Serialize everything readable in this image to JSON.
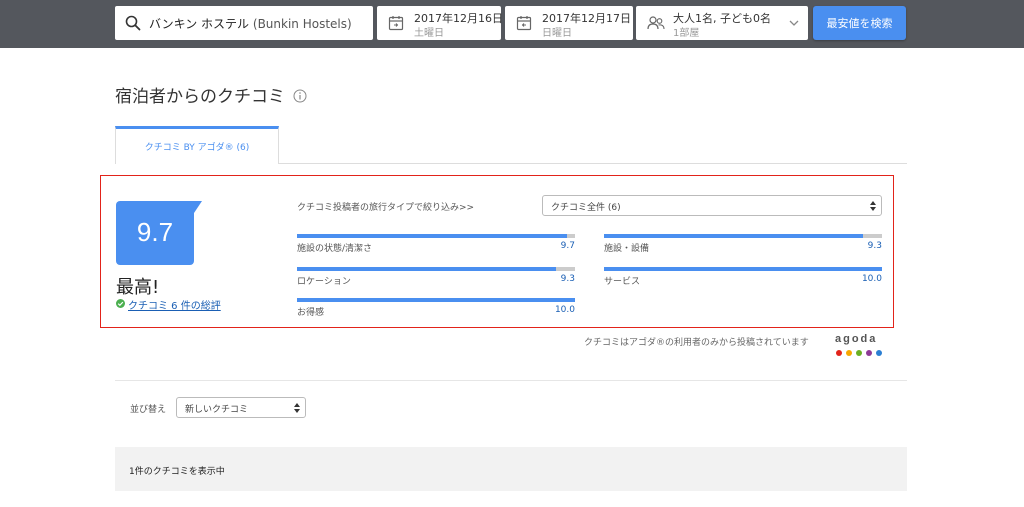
{
  "search": {
    "hotel_name": "バンキン ホステル",
    "hotel_en": "(Bunkin Hostels)",
    "checkin_date": "2017年12月16日",
    "checkin_day": "土曜日",
    "checkout_date": "2017年12月17日",
    "checkout_day": "日曜日",
    "guests": "大人1名, 子ども0名",
    "rooms": "1部屋",
    "button_label": "最安値を検索"
  },
  "page": {
    "title": "宿泊者からのクチコミ"
  },
  "tabs": [
    {
      "label": "クチコミ BY アゴダ® (6)"
    }
  ],
  "summary": {
    "score": "9.7",
    "score_word": "最高!",
    "total_link": "クチコミ 6 件の総評",
    "filter_label": "クチコミ投稿者の旅行タイプで絞り込み>>",
    "filter_value": "クチコミ全件 (6)",
    "categories": [
      {
        "label": "施設の状態/清潔さ",
        "value": "9.7",
        "fraction": 0.97
      },
      {
        "label": "施設・設備",
        "value": "9.3",
        "fraction": 0.93
      },
      {
        "label": "ロケーション",
        "value": "9.3",
        "fraction": 0.93
      },
      {
        "label": "サービス",
        "value": "10.0",
        "fraction": 1.0
      },
      {
        "label": "お得感",
        "value": "10.0",
        "fraction": 1.0
      }
    ]
  },
  "notice": {
    "text": "クチコミはアゴダ®の利用者のみから投稿されています",
    "logo_text": "agoda",
    "logo_colors": [
      "#e2231a",
      "#f7a800",
      "#6ab023",
      "#8e3a96",
      "#2b7fd3"
    ]
  },
  "sort": {
    "label": "並び替え",
    "value": "新しいクチコミ"
  },
  "results": {
    "count_text": "1件のクチコミを表示中"
  },
  "colors": {
    "accent": "#4a8ff0",
    "highlight_border": "#e2231a",
    "topbar": "#54575d"
  }
}
